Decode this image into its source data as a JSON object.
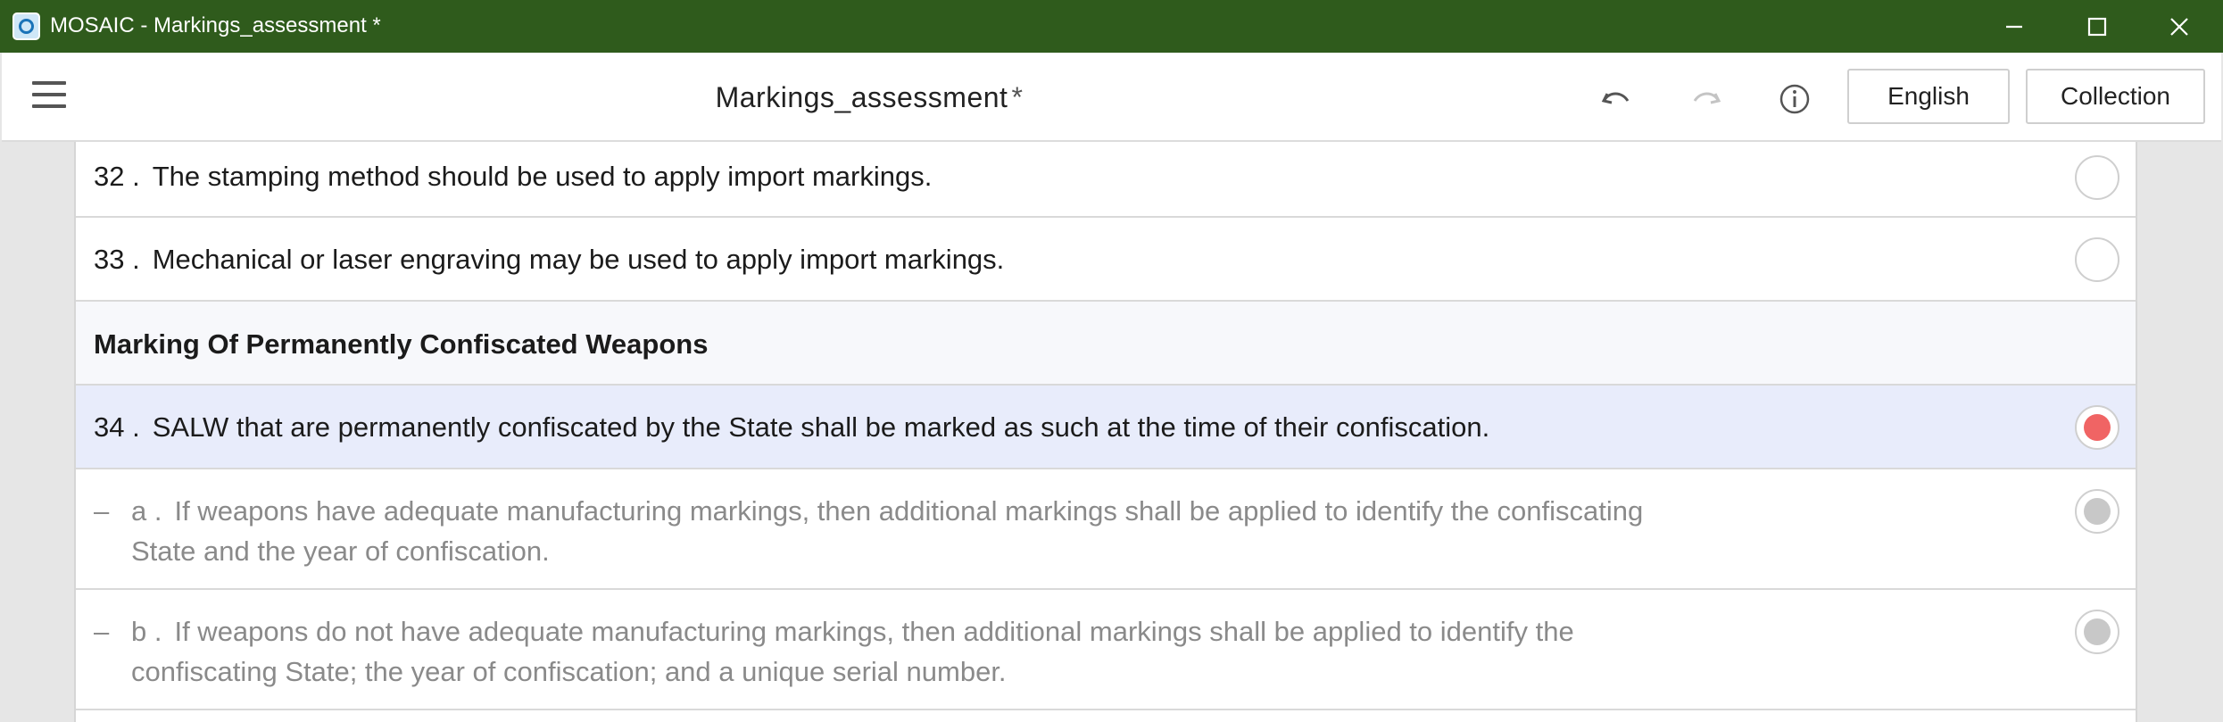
{
  "window": {
    "title": "MOSAIC - Markings_assessment *"
  },
  "header": {
    "doc_title": "Markings_assessment",
    "modified_marker": "*",
    "language_label": "English",
    "collection_label": "Collection"
  },
  "items": [
    {
      "num": "32 .",
      "text": "The stamping method should be used to apply import markings.",
      "state": "empty"
    },
    {
      "num": "33 .",
      "text": "Mechanical or laser engraving may be used to apply import markings.",
      "state": "empty"
    },
    {
      "section": "Marking Of Permanently Confiscated Weapons"
    },
    {
      "num": "34 .",
      "text": "SALW that are permanently confiscated by the State shall be marked as such at the time of their confiscation.",
      "state": "red",
      "selected": true
    },
    {
      "dash": "–",
      "num": "a .",
      "text_line1": "If weapons have adequate manufacturing markings, then additional markings shall be applied to identify the confiscating",
      "text_line2": "State and the year of confiscation.",
      "state": "gray"
    },
    {
      "dash": "–",
      "num": "b .",
      "text_line1": "If weapons do not have adequate manufacturing markings, then additional markings shall be applied to identify the",
      "text_line2": "confiscating State; the year of confiscation; and a unique serial number.",
      "state": "gray"
    }
  ],
  "colors": {
    "titlebar": "#2f5b1c",
    "status_red": "#f06464",
    "status_gray": "#c8c8c8",
    "selected_row": "#e8ecfb"
  }
}
